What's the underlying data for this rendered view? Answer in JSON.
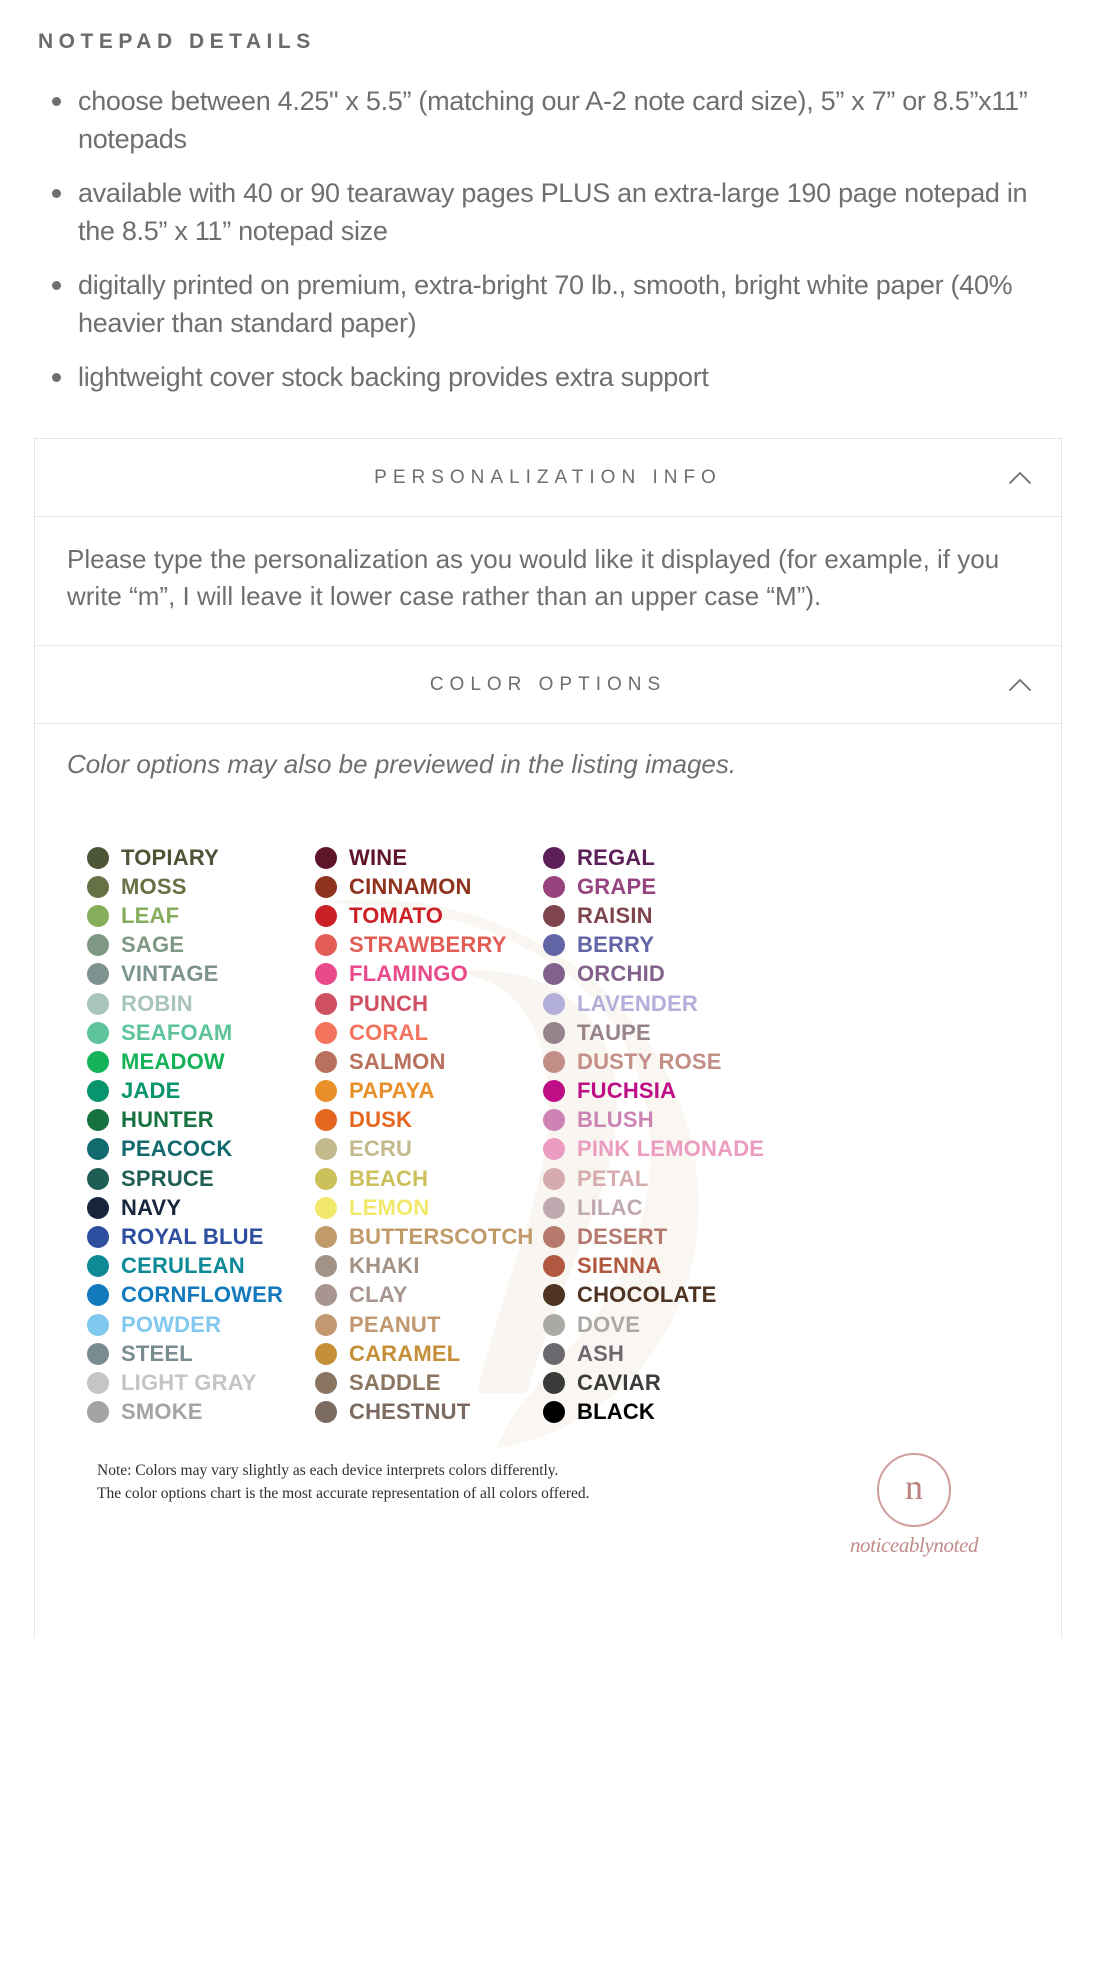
{
  "section": {
    "title": "NOTEPAD DETAILS",
    "bullets": [
      "choose between 4.25\" x 5.5” (matching our A-2 note card size), 5” x 7” or 8.5”x11” notepads",
      "available with 40 or 90 tearaway pages PLUS an extra-large 190 page notepad in the 8.5” x 11” notepad size",
      "digitally printed on premium, extra-bright 70 lb., smooth, bright white paper (40% heavier than standard paper)",
      "lightweight cover stock backing provides extra support"
    ]
  },
  "accordions": [
    {
      "id": "personalization-info",
      "title": "PERSONALIZATION INFO",
      "icon": "chevron-up-icon",
      "body": "Please type the personalization as you would like it displayed (for example, if you write “m”, I will leave it lower case rather than an upper case “M”)."
    },
    {
      "id": "color-options",
      "title": "COLOR OPTIONS",
      "icon": "chevron-up-icon",
      "body": "Color options may also be previewed in the listing images."
    }
  ],
  "color_chart": {
    "columns": [
      {
        "name": "greens-blues",
        "swatches": [
          {
            "label": "TOPIARY",
            "hex": "#4c5536"
          },
          {
            "label": "MOSS",
            "hex": "#667246"
          },
          {
            "label": "LEAF",
            "hex": "#86ad5c"
          },
          {
            "label": "SAGE",
            "hex": "#7f9883"
          },
          {
            "label": "VINTAGE",
            "hex": "#7d938f"
          },
          {
            "label": "ROBIN",
            "hex": "#a9c4bd"
          },
          {
            "label": "SEAFOAM",
            "hex": "#5cc39b"
          },
          {
            "label": "MEADOW",
            "hex": "#14b359"
          },
          {
            "label": "JADE",
            "hex": "#07956d"
          },
          {
            "label": "HUNTER",
            "hex": "#17713f"
          },
          {
            "label": "PEACOCK",
            "hex": "#12696e"
          },
          {
            "label": "SPRUCE",
            "hex": "#1f5e55"
          },
          {
            "label": "NAVY",
            "hex": "#18263d"
          },
          {
            "label": "ROYAL BLUE",
            "hex": "#2e4fa0"
          },
          {
            "label": "CERULEAN",
            "hex": "#0e8a96"
          },
          {
            "label": "CORNFLOWER",
            "hex": "#1279bc"
          },
          {
            "label": "POWDER",
            "hex": "#81c8ef"
          },
          {
            "label": "STEEL",
            "hex": "#798c91"
          },
          {
            "label": "LIGHT GRAY",
            "hex": "#c3c5c6"
          },
          {
            "label": "SMOKE",
            "hex": "#a4a4a4"
          }
        ]
      },
      {
        "name": "reds-neutrals",
        "swatches": [
          {
            "label": "WINE",
            "hex": "#5e1429"
          },
          {
            "label": "CINNAMON",
            "hex": "#90331e"
          },
          {
            "label": "TOMATO",
            "hex": "#cb2026"
          },
          {
            "label": "STRAWBERRY",
            "hex": "#e35d57"
          },
          {
            "label": "FLAMINGO",
            "hex": "#e84a8b"
          },
          {
            "label": "PUNCH",
            "hex": "#cf4f63"
          },
          {
            "label": "CORAL",
            "hex": "#f4735d"
          },
          {
            "label": "SALMON",
            "hex": "#b9705d"
          },
          {
            "label": "PAPAYA",
            "hex": "#e8912a"
          },
          {
            "label": "DUSK",
            "hex": "#e4661f"
          },
          {
            "label": "ECRU",
            "hex": "#c3b98d"
          },
          {
            "label": "BEACH",
            "hex": "#cbc05a"
          },
          {
            "label": "LEMON",
            "hex": "#f2e96c"
          },
          {
            "label": "BUTTERSCOTCH",
            "hex": "#c09a68"
          },
          {
            "label": "KHAKI",
            "hex": "#a39286"
          },
          {
            "label": "CLAY",
            "hex": "#a8958f"
          },
          {
            "label": "PEANUT",
            "hex": "#c29870"
          },
          {
            "label": "CARAMEL",
            "hex": "#c58f37"
          },
          {
            "label": "SADDLE",
            "hex": "#8a7561"
          },
          {
            "label": "CHESTNUT",
            "hex": "#7b6a5f"
          }
        ]
      },
      {
        "name": "purples-browns",
        "swatches": [
          {
            "label": "REGAL",
            "hex": "#5c1f57"
          },
          {
            "label": "GRAPE",
            "hex": "#96437f"
          },
          {
            "label": "RAISIN",
            "hex": "#7e464c"
          },
          {
            "label": "BERRY",
            "hex": "#6266a7"
          },
          {
            "label": "ORCHID",
            "hex": "#82628a"
          },
          {
            "label": "LAVENDER",
            "hex": "#b3afdb"
          },
          {
            "label": "TAUPE",
            "hex": "#96838c"
          },
          {
            "label": "DUSTY ROSE",
            "hex": "#c28e85"
          },
          {
            "label": "FUCHSIA",
            "hex": "#bf0d86"
          },
          {
            "label": "BLUSH",
            "hex": "#cd84b4"
          },
          {
            "label": "PINK LEMONADE",
            "hex": "#eb9cc0"
          },
          {
            "label": "PETAL",
            "hex": "#d6abad"
          },
          {
            "label": "LILAC",
            "hex": "#c0a8b1"
          },
          {
            "label": "DESERT",
            "hex": "#b5796d"
          },
          {
            "label": "SIENNA",
            "hex": "#b05940"
          },
          {
            "label": "CHOCOLATE",
            "hex": "#4e3322"
          },
          {
            "label": "DOVE",
            "hex": "#aaa9a4"
          },
          {
            "label": "ASH",
            "hex": "#6c6870"
          },
          {
            "label": "CAVIAR",
            "hex": "#3b3b3b"
          },
          {
            "label": "BLACK",
            "hex": "#000000"
          }
        ]
      }
    ],
    "note_lines": [
      "Note: Colors may vary slightly as each device interprets colors differently.",
      "The color options chart is the most accurate representation of all colors offered."
    ],
    "logo": {
      "monogram": "n",
      "word_1": "noticeably",
      "word_2": "noted"
    }
  }
}
